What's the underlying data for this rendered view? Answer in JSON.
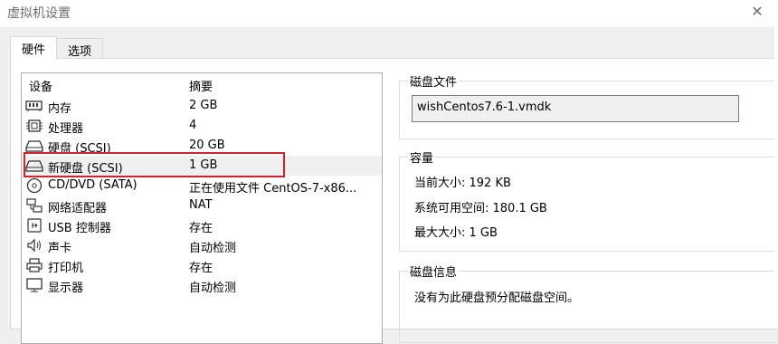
{
  "window": {
    "title": "虚拟机设置"
  },
  "tabs": [
    {
      "label": "硬件",
      "active": true
    },
    {
      "label": "选项",
      "active": false
    }
  ],
  "device_list": {
    "headers": {
      "device": "设备",
      "summary": "摘要"
    },
    "rows": [
      {
        "icon": "memory-icon",
        "name": "内存",
        "summary": "2 GB"
      },
      {
        "icon": "processor-icon",
        "name": "处理器",
        "summary": "4"
      },
      {
        "icon": "harddisk-icon",
        "name": "硬盘 (SCSI)",
        "summary": "20 GB"
      },
      {
        "icon": "harddisk-icon",
        "name": "新硬盘 (SCSI)",
        "summary": "1 GB",
        "selected": true
      },
      {
        "icon": "cd-dvd-icon",
        "name": "CD/DVD (SATA)",
        "summary": "正在使用文件 CentOS-7-x86..."
      },
      {
        "icon": "network-adapter-icon",
        "name": "网络适配器",
        "summary": "NAT"
      },
      {
        "icon": "usb-icon",
        "name": "USB 控制器",
        "summary": "存在"
      },
      {
        "icon": "sound-card-icon",
        "name": "声卡",
        "summary": "自动检测"
      },
      {
        "icon": "printer-icon",
        "name": "打印机",
        "summary": "存在"
      },
      {
        "icon": "display-icon",
        "name": "显示器",
        "summary": "自动检测"
      }
    ]
  },
  "disk_file": {
    "label": "磁盘文件",
    "value": "wishCentos7.6-1.vmdk"
  },
  "capacity": {
    "label": "容量",
    "current_size": "当前大小: 192 KB",
    "available_space": "系统可用空间: 180.1 GB",
    "max_size": "最大大小: 1 GB"
  },
  "disk_info": {
    "label": "磁盘信息",
    "line1": "没有为此硬盘预分配磁盘空间。"
  },
  "colors": {
    "highlight_border": "#d1242f",
    "selected_row": "#f0f0f0"
  }
}
